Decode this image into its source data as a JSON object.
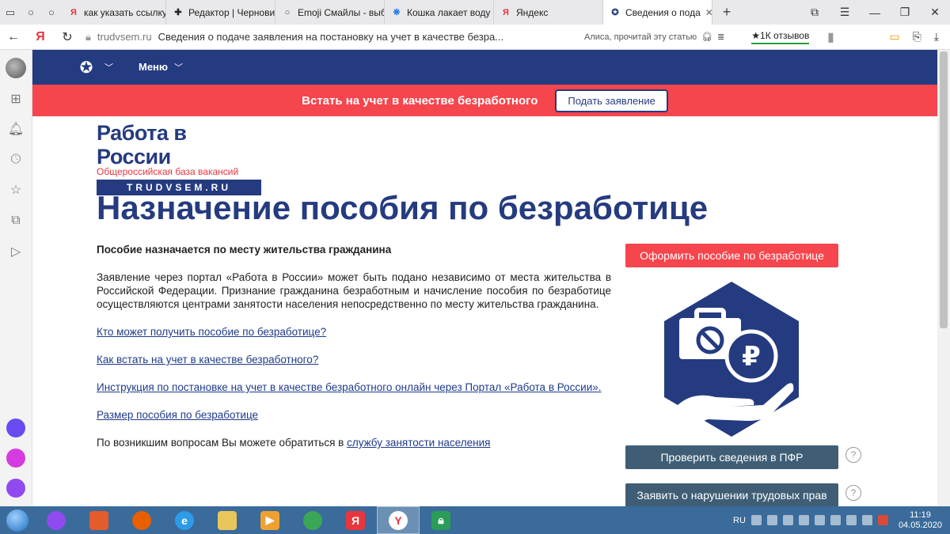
{
  "browser": {
    "tabs": [
      {
        "label": "как указать ссылку",
        "favicon": "Я",
        "favicon_color": "#e8363e"
      },
      {
        "label": "Редактор | Черновик",
        "favicon": "✚",
        "favicon_color": "#222"
      },
      {
        "label": "Emoji Смайлы - выб",
        "favicon": "○",
        "favicon_color": "#444"
      },
      {
        "label": "Кошка лакает воду",
        "favicon": "❋",
        "favicon_color": "#2f7de1"
      },
      {
        "label": "Яндекс",
        "favicon": "Я",
        "favicon_color": "#e8363e"
      },
      {
        "label": "Сведения о пода",
        "favicon": "✪",
        "favicon_color": "#253b80",
        "active": true
      }
    ],
    "new_tab": "+",
    "url_domain": "trudvsem.ru",
    "page_title": "Сведения о подаче заявления на постановку на учет в качестве безра...",
    "alisa_prompt": "Алиса, прочитай эту статью",
    "reviews": "★1К отзывов",
    "yandex_logo": "Я"
  },
  "site": {
    "menu_label": "Меню",
    "red_bar_text": "Встать на учет в качестве безработного",
    "apply_button": "Подать заявление",
    "logo_title": "Работа в России",
    "logo_subtitle": "Общероссийская база вакансий",
    "logo_domain": "TRUDVSEM.RU",
    "heading": "Назначение пособия по безработице",
    "lead": "Пособие назначается по месту жительства гражданина",
    "paragraph": "Заявление через портал «Работа в России» может быть подано независимо от места жительства в Российской Федерации. Признание гражданина безработным и начисление пособия по безработице осуществляются центрами занятости населения непосредственно по месту жительства гражданина.",
    "links": [
      "Кто может получить пособие по безработице?",
      "Как встать на учет в качестве безработного?",
      "Инструкция по постановке на учет в качестве безработного онлайн через Портал «Работа в России».",
      "Размер пособия по безработице"
    ],
    "contact_text": "По возникшим вопросам Вы можете обратиться в ",
    "contact_link": "службу занятости населения",
    "benefit_button": "Оформить пособие по безработице",
    "pfr_button": "Проверить сведения в ПФР",
    "labor_button": "Заявить о нарушении трудовых прав",
    "help_symbol": "?"
  },
  "taskbar": {
    "language": "RU",
    "time": "11:19",
    "date": "04.05.2020"
  },
  "colors": {
    "brand_blue": "#253b80",
    "brand_red": "#f5454d",
    "slate_button": "#3f5e75"
  }
}
